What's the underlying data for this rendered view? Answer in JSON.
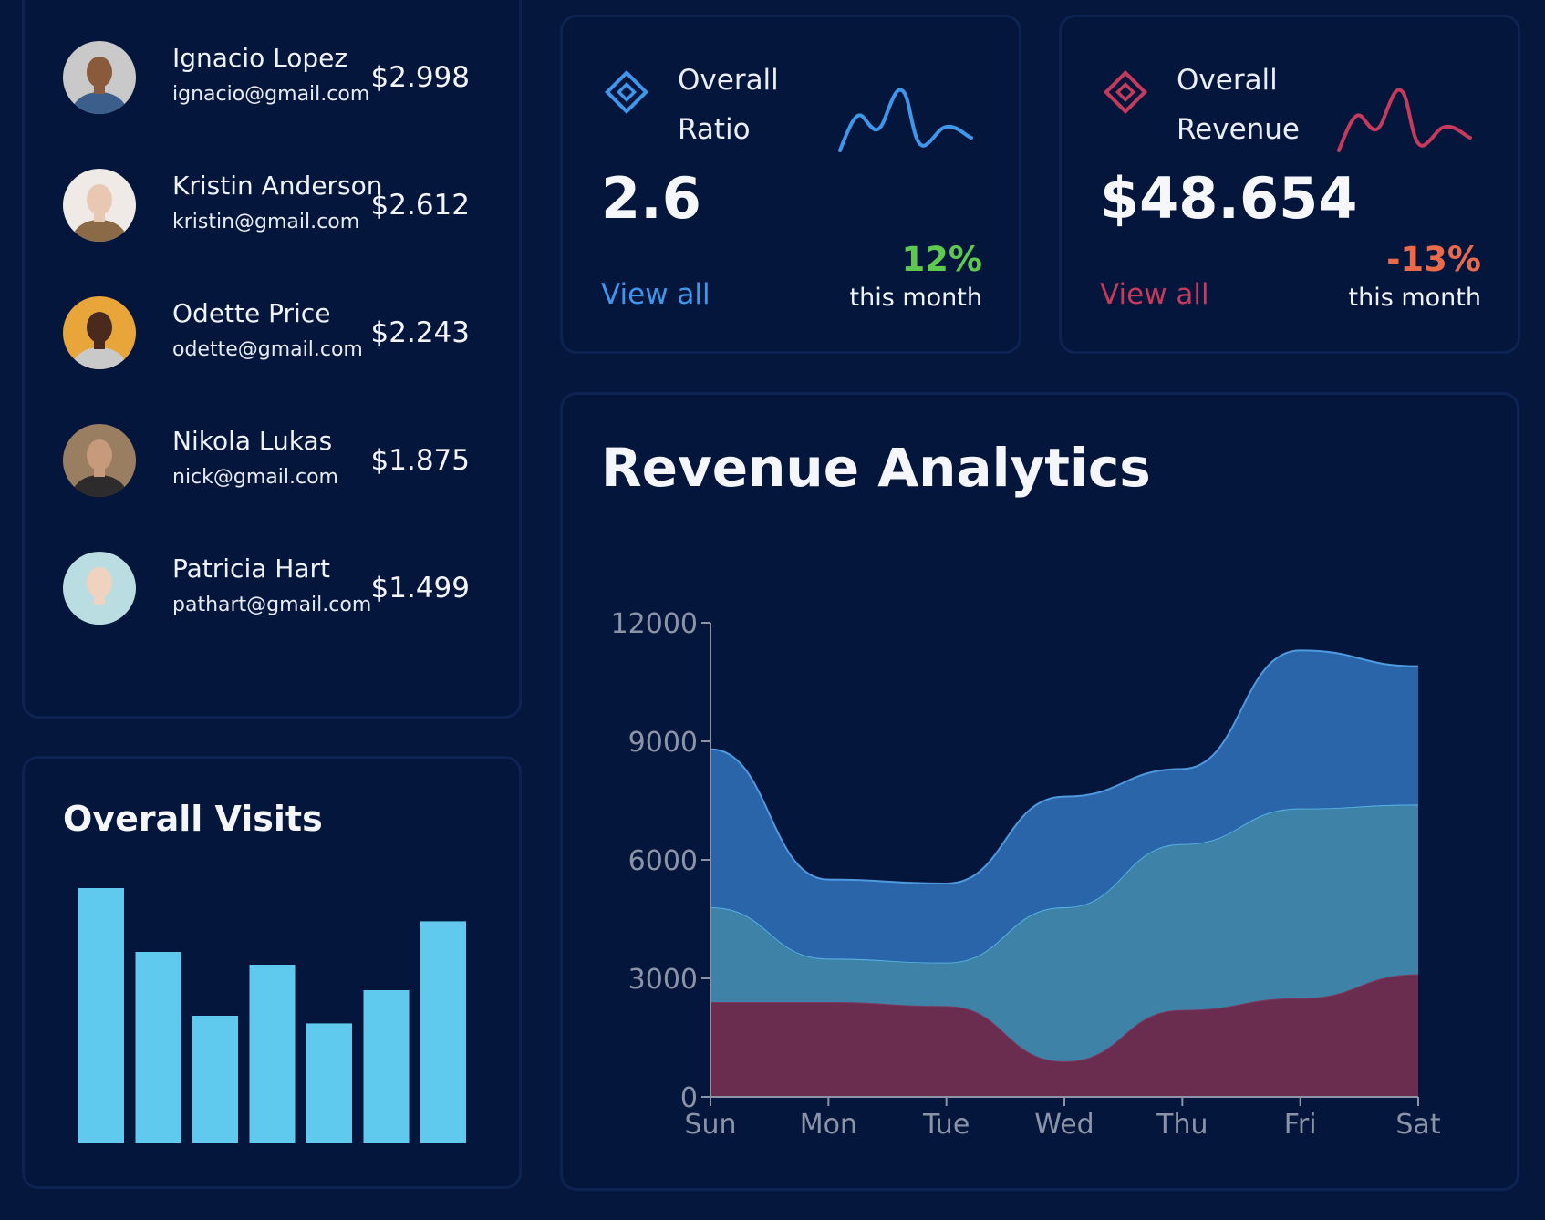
{
  "users": [
    {
      "name": "Ignacio Lopez",
      "email": "ignacio@gmail.com",
      "amount": "$2.998",
      "avatar_bg": "#c9c9c9",
      "skin": "#8a5a3c",
      "shirt": "#3b5f8a"
    },
    {
      "name": "Kristin Anderson",
      "email": "kristin@gmail.com",
      "amount": "$2.612",
      "avatar_bg": "#efeae6",
      "skin": "#e8c8b3",
      "shirt": "#8b6a48"
    },
    {
      "name": "Odette Price",
      "email": "odette@gmail.com",
      "amount": "$2.243",
      "avatar_bg": "#e8a53a",
      "skin": "#4a2a1c",
      "shirt": "#c9c9c9"
    },
    {
      "name": "Nikola Lukas",
      "email": "nick@gmail.com",
      "amount": "$1.875",
      "avatar_bg": "#9a7e62",
      "skin": "#c69a7a",
      "shirt": "#2d2b2b"
    },
    {
      "name": "Patricia Hart",
      "email": "pathart@gmail.com",
      "amount": "$1.499",
      "avatar_bg": "#b9dde0",
      "skin": "#f0d2c0",
      "shirt": "#b9dde0"
    }
  ],
  "visits": {
    "title": "Overall Visits",
    "bar_color": "#5fc9ee",
    "values": [
      100,
      75,
      50,
      70,
      47,
      60,
      87
    ]
  },
  "stats": {
    "ratio": {
      "label_line1": "Overall",
      "label_line2": "Ratio",
      "value": "2.6",
      "link": "View all",
      "change": "12%",
      "sub": "this month",
      "accent": "#3f97ec",
      "change_color": "#5fc84f",
      "icon": "diamond-icon"
    },
    "revenue": {
      "label_line1": "Overall",
      "label_line2": "Revenue",
      "value": "$48.654",
      "link": "View all",
      "change": "-13%",
      "sub": "this month",
      "accent": "#c63a5c",
      "change_color": "#ea6a4c",
      "icon": "diamond-icon"
    }
  },
  "analytics": {
    "title": "Revenue Analytics"
  },
  "chart_data": {
    "type": "area",
    "stacked": true,
    "categories": [
      "Sun",
      "Mon",
      "Tue",
      "Wed",
      "Thu",
      "Fri",
      "Sat"
    ],
    "ylim": [
      0,
      12000
    ],
    "yticks": [
      0,
      3000,
      6000,
      9000,
      12000
    ],
    "series": [
      {
        "values": [
          2400,
          2400,
          2300,
          900,
          2200,
          2500,
          3100
        ],
        "color": "#6a2d50",
        "line": "#7a3a5e"
      },
      {
        "values": [
          2400,
          1100,
          1100,
          3900,
          4200,
          4800,
          4300
        ],
        "color": "#3e82a8",
        "line": "#56b0e4"
      },
      {
        "values": [
          4000,
          2000,
          2000,
          2800,
          1900,
          4000,
          3500
        ],
        "color": "#2965a8",
        "line": "#4e9ae0"
      }
    ],
    "grid": false
  }
}
